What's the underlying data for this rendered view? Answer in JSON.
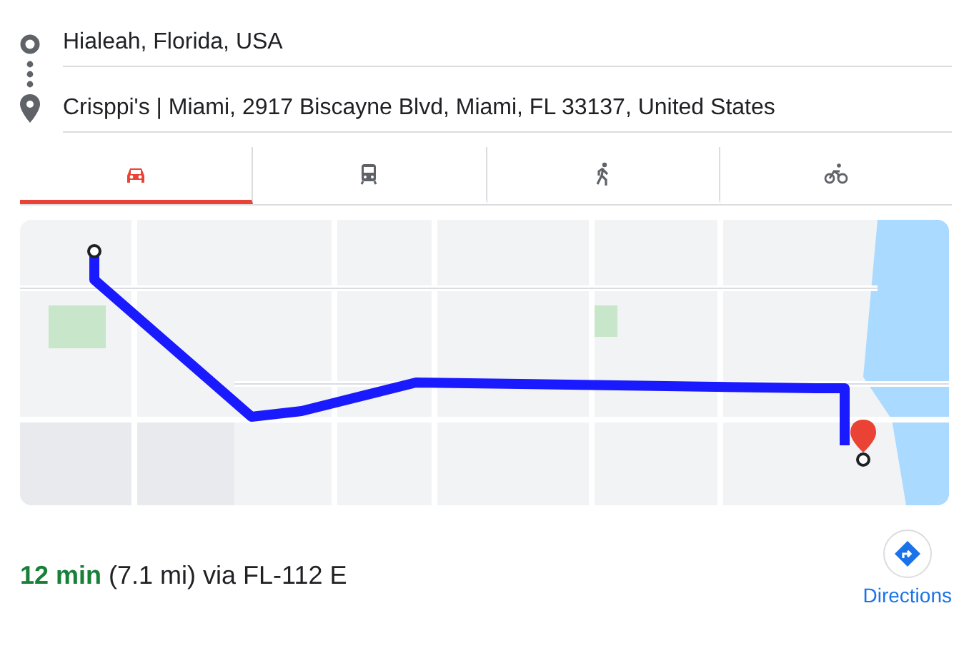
{
  "origin": {
    "value": "Hialeah, Florida, USA"
  },
  "destination": {
    "value": "Crisppi's | Miami, 2917 Biscayne Blvd, Miami, FL 33137, United States"
  },
  "travel_modes": [
    {
      "kind": "car",
      "selected": true
    },
    {
      "kind": "transit",
      "selected": false
    },
    {
      "kind": "walk",
      "selected": false
    },
    {
      "kind": "bike",
      "selected": false
    }
  ],
  "route": {
    "summary": "**12 min** (7.1 mi) via FL-112 E"
  },
  "directions_button": {
    "label": "Directions"
  }
}
